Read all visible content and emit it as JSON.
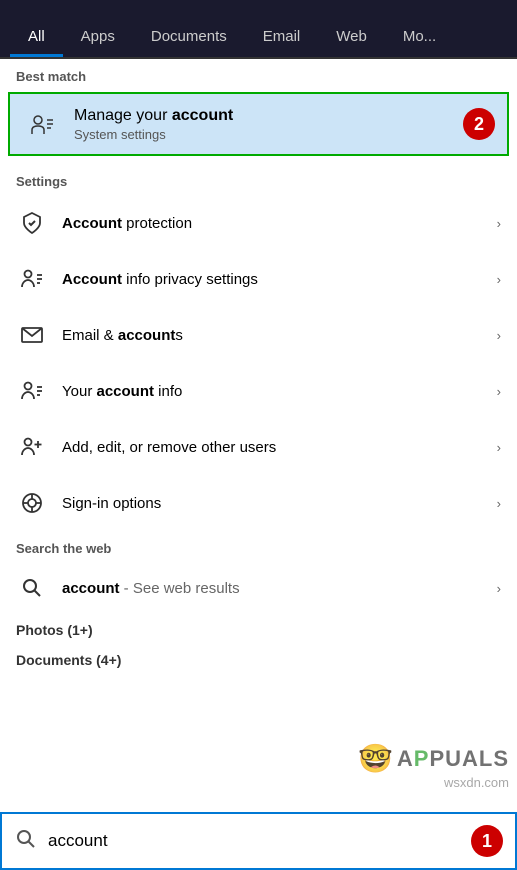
{
  "tabs": [
    {
      "label": "All",
      "active": true
    },
    {
      "label": "Apps",
      "active": false
    },
    {
      "label": "Documents",
      "active": false
    },
    {
      "label": "Email",
      "active": false
    },
    {
      "label": "Web",
      "active": false
    },
    {
      "label": "Mo...",
      "active": false
    }
  ],
  "best_match": {
    "section_label": "Best match",
    "title_prefix": "Manage your ",
    "title_bold": "account",
    "subtitle": "System settings",
    "badge": "2"
  },
  "settings": {
    "section_label": "Settings",
    "items": [
      {
        "label_prefix": "",
        "label_bold": "Account",
        "label_suffix": " protection",
        "chevron": true
      },
      {
        "label_prefix": "",
        "label_bold": "Account",
        "label_suffix": " info privacy settings",
        "chevron": true
      },
      {
        "label_prefix": "Email & ",
        "label_bold": "account",
        "label_suffix": "s",
        "chevron": true
      },
      {
        "label_prefix": "Your ",
        "label_bold": "account",
        "label_suffix": " info",
        "chevron": true
      },
      {
        "label_prefix": "Add, edit, or remove other users",
        "label_bold": "",
        "label_suffix": "",
        "chevron": true
      },
      {
        "label_prefix": "Sign-in options",
        "label_bold": "",
        "label_suffix": "",
        "chevron": true
      }
    ]
  },
  "web_search": {
    "section_label": "Search the web",
    "query": "account",
    "see_results": " - See web results",
    "chevron": true
  },
  "photos": {
    "label": "Photos (1+)"
  },
  "documents": {
    "label": "Documents (4+)"
  },
  "search_bar": {
    "placeholder": "account",
    "value": "account",
    "badge": "1"
  },
  "watermark": {
    "site": "wsxdn.com"
  },
  "appuals": {
    "text": "APPUALS"
  }
}
